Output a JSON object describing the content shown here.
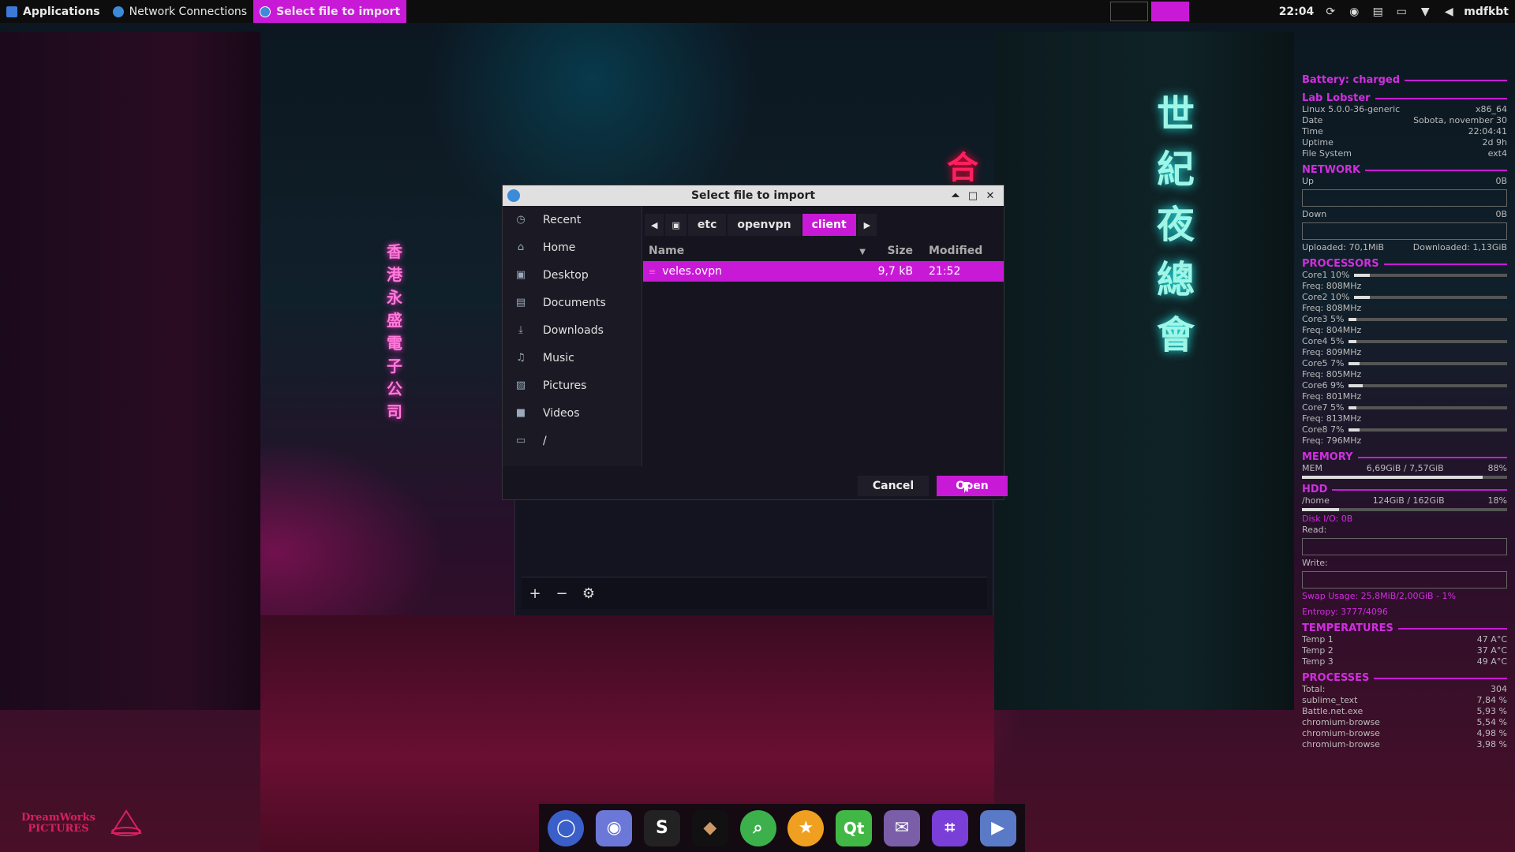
{
  "topbar": {
    "applications": "Applications",
    "tasks": [
      {
        "label": "Network Connections",
        "active": false
      },
      {
        "label": "Select file to import",
        "active": true
      }
    ],
    "time": "22:04",
    "username": "mdfkbt",
    "accent_color": "#c81ad6"
  },
  "dialog": {
    "title": "Select file to import",
    "places": [
      {
        "label": "Recent",
        "icon": "clock-icon"
      },
      {
        "label": "Home",
        "icon": "home-icon"
      },
      {
        "label": "Desktop",
        "icon": "desktop-icon"
      },
      {
        "label": "Documents",
        "icon": "document-icon"
      },
      {
        "label": "Downloads",
        "icon": "download-icon"
      },
      {
        "label": "Music",
        "icon": "music-icon"
      },
      {
        "label": "Pictures",
        "icon": "picture-icon"
      },
      {
        "label": "Videos",
        "icon": "video-icon"
      },
      {
        "label": "/",
        "icon": "folder-icon"
      }
    ],
    "path": [
      "etc",
      "openvpn",
      "client"
    ],
    "columns": {
      "name": "Name",
      "size": "Size",
      "modified": "Modified"
    },
    "files": [
      {
        "name": "veles.ovpn",
        "size": "9,7 kB",
        "modified": "21:52",
        "selected": true
      }
    ],
    "cancel_label": "Cancel",
    "open_label": "Open"
  },
  "conky": {
    "battery": "Battery: charged",
    "host": "Lab Lobster",
    "sys": [
      {
        "k": "Linux 5.0.0-36-generic",
        "v": "x86_64"
      },
      {
        "k": "Date",
        "v": "Sobota, november 30"
      },
      {
        "k": "Time",
        "v": "22:04:41"
      },
      {
        "k": "Uptime",
        "v": "2d 9h"
      },
      {
        "k": "File System",
        "v": "ext4"
      }
    ],
    "network": {
      "title": "NETWORK",
      "up_label": "Up",
      "up_val": "0B",
      "down_label": "Down",
      "down_val": "0B",
      "uploaded": "Uploaded: 70,1MiB",
      "downloaded": "Downloaded: 1,13GiB"
    },
    "processors": {
      "title": "PROCESSORS",
      "cores": [
        {
          "core": "Core1 10%",
          "freq": "Freq: 808MHz",
          "pct": 10
        },
        {
          "core": "Core2 10%",
          "freq": "Freq: 808MHz",
          "pct": 10
        },
        {
          "core": "Core3 5%",
          "freq": "Freq: 804MHz",
          "pct": 5
        },
        {
          "core": "Core4 5%",
          "freq": "Freq: 809MHz",
          "pct": 5
        },
        {
          "core": "Core5 7%",
          "freq": "Freq: 805MHz",
          "pct": 7
        },
        {
          "core": "Core6 9%",
          "freq": "Freq: 801MHz",
          "pct": 9
        },
        {
          "core": "Core7 5%",
          "freq": "Freq: 813MHz",
          "pct": 5
        },
        {
          "core": "Core8 7%",
          "freq": "Freq: 796MHz",
          "pct": 7
        }
      ]
    },
    "memory": {
      "title": "MEMORY",
      "label": "MEM",
      "value": "6,69GiB / 7,57GiB",
      "pct_label": "88%",
      "pct": 88
    },
    "hdd": {
      "title": "HDD",
      "label": "/home",
      "value": "124GiB / 162GiB",
      "pct_label": "18%",
      "pct": 18,
      "disk_io": "Disk I/O: 0B",
      "read": "Read:",
      "write": "Write:",
      "swap": "Swap Usage: 25,8MiB/2,00GiB - 1%",
      "entropy": "Entropy: 3777/4096"
    },
    "temps": {
      "title": "TEMPERATURES",
      "items": [
        {
          "k": "Temp 1",
          "v": "47 A°C"
        },
        {
          "k": "Temp 2",
          "v": "37 A°C"
        },
        {
          "k": "Temp 3",
          "v": "49 A°C"
        }
      ]
    },
    "processes": {
      "title": "PROCESSES",
      "items": [
        {
          "k": "Total:",
          "v": "304"
        },
        {
          "k": "sublime_text",
          "v": "7,84 %"
        },
        {
          "k": "Battle.net.exe",
          "v": "5,93 %"
        },
        {
          "k": "chromium-browse",
          "v": "5,54 %"
        },
        {
          "k": "chromium-browse",
          "v": "4,98 %"
        },
        {
          "k": "chromium-browse",
          "v": "3,98 %"
        }
      ]
    }
  },
  "dock": [
    "chromium-icon",
    "discord-icon",
    "skype-icon",
    "app-dark-icon",
    "search-icon",
    "anki-icon",
    "qt-icon",
    "pidgin-icon",
    "crop-icon",
    "video-icon"
  ],
  "logos": {
    "dreamworks": "DreamWorks PICTURES"
  }
}
